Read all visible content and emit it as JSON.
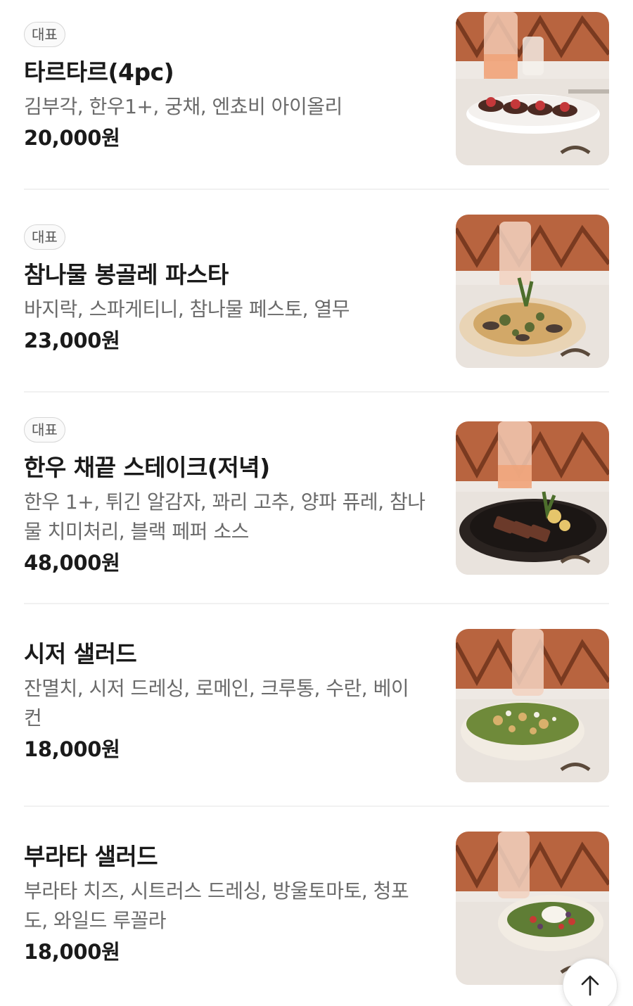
{
  "menu": {
    "items": [
      {
        "badge": "대표",
        "name": "타르타르(4pc)",
        "desc_lines": [
          "김부각, 한우1+, 궁채, 엔쵸비 아이올리"
        ],
        "price": "20,000원",
        "image": "tartare-dish-photo"
      },
      {
        "badge": "대표",
        "name": "참나물 봉골레 파스타",
        "desc_lines": [
          "바지락, 스파게티니, 참나물 페스토, 열무"
        ],
        "price": "23,000원",
        "image": "vongole-pasta-photo"
      },
      {
        "badge": "대표",
        "name": "한우 채끝 스테이크(저녁)",
        "desc_lines": [
          "한우 1+, 튀긴 알감자, 꽈리 고추, 양파 퓨레, 참나",
          "물 치미처리, 블랙 페퍼 소스"
        ],
        "price": "48,000원",
        "image": "steak-dish-photo"
      },
      {
        "name": "시저 샐러드",
        "desc_lines": [
          "잔멸치, 시저 드레싱, 로메인, 크루통, 수란, 베이",
          "컨"
        ],
        "price": "18,000원",
        "image": "caesar-salad-photo"
      },
      {
        "name": "부라타 샐러드",
        "desc_lines": [
          "부라타 치즈, 시트러스 드레싱, 방울토마토, 청포",
          "도, 와일드 루꼴라"
        ],
        "price": "18,000원",
        "image": "burrata-salad-photo"
      }
    ]
  },
  "scroll_top": {
    "icon": "arrow-up-icon"
  },
  "colors": {
    "background": "#ffffff",
    "text": "#1a1a1a",
    "muted": "#6a6a6a",
    "badge_border": "#d6d6d6"
  }
}
